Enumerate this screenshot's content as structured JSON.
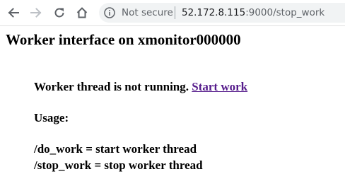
{
  "browser": {
    "security_label": "Not secure",
    "url_host": "52.172.8.115",
    "url_rest": ":9000/stop_work",
    "icons": {
      "back": "back-arrow-icon",
      "forward": "forward-arrow-icon",
      "reload": "reload-icon",
      "home": "home-icon",
      "info": "info-icon"
    }
  },
  "page": {
    "title": "Worker interface on xmonitor000000",
    "status_text": "Worker thread is not running. ",
    "start_link": "Start work",
    "usage_label": "Usage:",
    "usage_lines": [
      "/do_work = start worker thread",
      "/stop_work = stop worker thread"
    ]
  },
  "colors": {
    "link_visited": "#551a8b",
    "omnibox_bg": "#f1f3f4",
    "chrome_icon": "#5f6368"
  }
}
